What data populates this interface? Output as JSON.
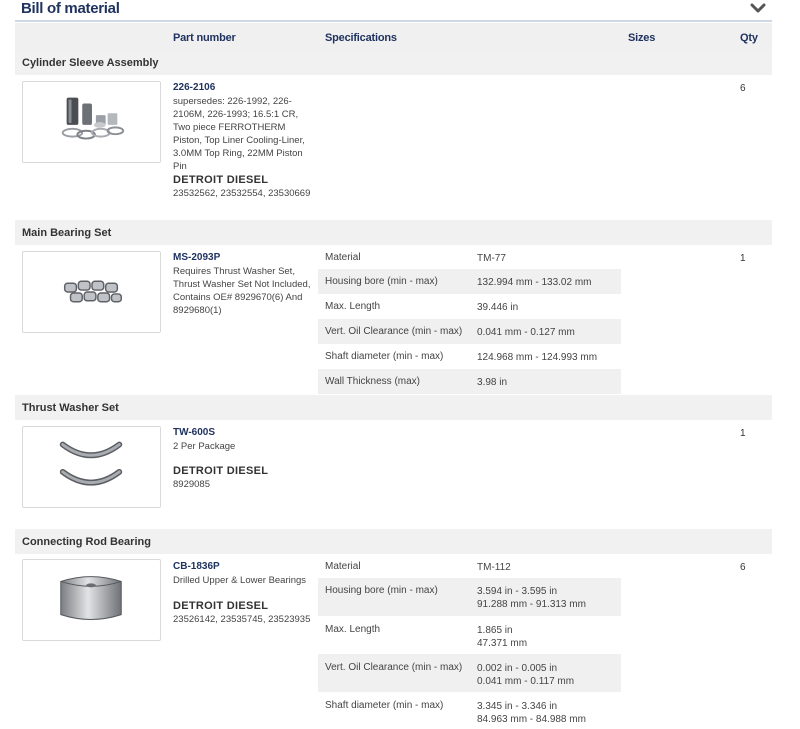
{
  "page": {
    "title": "Bill of material"
  },
  "columns": {
    "part_number": "Part number",
    "specifications": "Specifications",
    "sizes": "Sizes",
    "qty": "Qty"
  },
  "groups": [
    {
      "name": "Cylinder Sleeve Assembly",
      "part_number": "226-2106",
      "description": "supersedes: 226-1992, 226-2106M, 226-1993; 16.5:1 CR, Two piece FERROTHERM Piston, Top Liner Cooling-Liner, 3.0MM Top Ring, 22MM Piston Pin",
      "brand": "DETROIT DIESEL",
      "oe_numbers": "23532562, 23532554, 23530669",
      "qty": "6"
    },
    {
      "name": "Main Bearing Set",
      "part_number": "MS-2093P",
      "description": "Requires Thrust Washer Set, Thrust Washer Set Not Included, Contains OE# 8929670(6) And 8929680(1)",
      "qty": "1",
      "specs": [
        {
          "label": "Material",
          "value": "TM-77"
        },
        {
          "label": "Housing bore (min - max)",
          "value": "132.994 mm - 133.02 mm"
        },
        {
          "label": "Max. Length",
          "value": "39.446 in"
        },
        {
          "label": "Vert. Oil Clearance (min - max)",
          "value": "0.041 mm - 0.127 mm"
        },
        {
          "label": "Shaft diameter (min - max)",
          "value": "124.968 mm - 124.993 mm"
        },
        {
          "label": "Wall Thickness (max)",
          "value": "3.98 in"
        }
      ]
    },
    {
      "name": "Thrust Washer Set",
      "part_number": "TW-600S",
      "description": "2 Per Package",
      "brand": "DETROIT DIESEL",
      "oe_numbers": "8929085",
      "qty": "1"
    },
    {
      "name": "Connecting Rod Bearing",
      "part_number": "CB-1836P",
      "description": "Drilled Upper & Lower Bearings",
      "brand": "DETROIT DIESEL",
      "oe_numbers": "23526142, 23535745, 23523935",
      "qty": "6",
      "specs": [
        {
          "label": "Material",
          "value": "TM-112"
        },
        {
          "label": "Housing bore (min - max)",
          "value_line1": "3.594 in - 3.595 in",
          "value_line2": "91.288 mm - 91.313 mm"
        },
        {
          "label": "Max. Length",
          "value_line1": "1.865 in",
          "value_line2": "47.371 mm"
        },
        {
          "label": "Vert. Oil Clearance (min - max)",
          "value_line1": "0.002 in - 0.005 in",
          "value_line2": "0.041 mm - 0.117 mm"
        },
        {
          "label": "Shaft diameter (min - max)",
          "value_line1": "3.345 in - 3.346 in",
          "value_line2": "84.963 mm - 84.988 mm"
        }
      ]
    }
  ],
  "icons": {
    "collapse": "chevron-down-icon"
  },
  "colors": {
    "accent": "#20335f",
    "header_bg": "#f0f0f0"
  }
}
